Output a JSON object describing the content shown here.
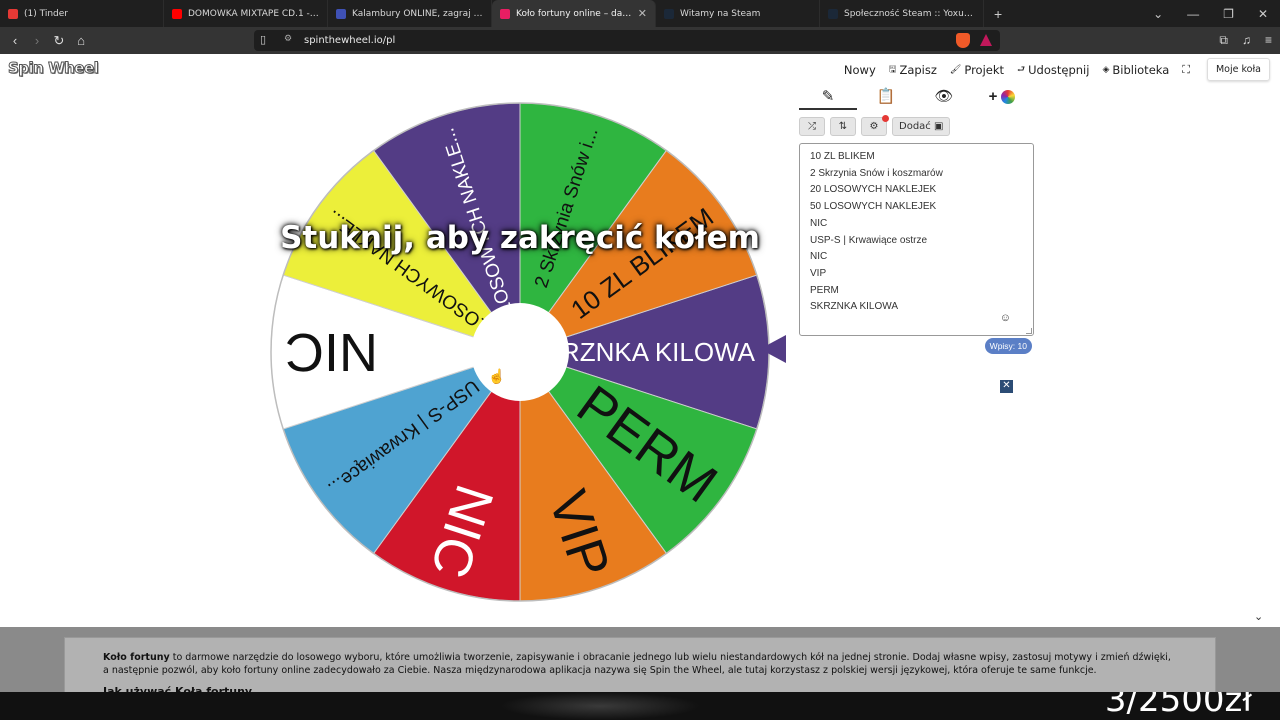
{
  "browser": {
    "tabs": [
      {
        "title": "(1) Tinder",
        "fav_color": "#e53935",
        "active": false
      },
      {
        "title": "DOMÓWKA MIXTAPE CD.1 - YouTube",
        "fav_color": "#ff0000",
        "active": false
      },
      {
        "title": "Kalambury ONLINE, zagraj - Kurnik",
        "fav_color": "#3f51b5",
        "active": false
      },
      {
        "title": "Koło fortuny online – darmowe losowanie",
        "fav_color": "#e91e63",
        "active": true
      },
      {
        "title": "Witamy na Steam",
        "fav_color": "#1b2838",
        "active": false
      },
      {
        "title": "Społeczność Steam :: Yoxumi :: Ekwipunek",
        "fav_color": "#1b2838",
        "active": false
      }
    ],
    "url": "spinthewheel.io/pl"
  },
  "site": {
    "logo": "Spin Wheel",
    "menu": {
      "nowy": "Nowy",
      "zapisz": "Zapisz",
      "projekt": "Projekt",
      "udostepnij": "Udostępnij",
      "biblioteka": "Biblioteka",
      "moje_kola": "Moje koła"
    },
    "tap_text": "Stuknij, aby zakręcić kołem"
  },
  "panel": {
    "add_label": "Dodać",
    "entries": [
      "10 ZL BLIKEM",
      "2 Skrzynia Snów i koszmarów",
      "20 LOSOWYCH NAKLEJEK",
      "50 LOSOWYCH NAKLEJEK",
      "NIC",
      "USP-S | Krwawiące ostrze",
      "NIC",
      "VIP",
      "PERM",
      "SKRZNKA KILOWA"
    ],
    "count_label": "Wpisy: 10"
  },
  "wheel": {
    "segments": [
      {
        "label": "SKRZNKA KILOWA",
        "color": "#533c85",
        "text_color": "#ffffff"
      },
      {
        "label": "PERM",
        "color": "#2fb540",
        "text_color": "#111111"
      },
      {
        "label": "VIP",
        "color": "#e87c1e",
        "text_color": "#111111"
      },
      {
        "label": "NIC",
        "color": "#d0162a",
        "text_color": "#ffffff"
      },
      {
        "label": "USP-S | Krwawiące...",
        "color": "#4fa3d1",
        "text_color": "#111111"
      },
      {
        "label": "NIC",
        "color": "#ffffff",
        "text_color": "#111111"
      },
      {
        "label": "50 LOSOWYCH NAKLE...",
        "color": "#ecef3a",
        "text_color": "#111111"
      },
      {
        "label": "20 LOSOWYCH NAKLE...",
        "color": "#533c85",
        "text_color": "#ffffff"
      },
      {
        "label": "2 Skrzynia Snów i...",
        "color": "#2fb540",
        "text_color": "#111111"
      },
      {
        "label": "10 ZL BLIKEM",
        "color": "#e87c1e",
        "text_color": "#111111"
      }
    ]
  },
  "info": {
    "brand": "Koło fortuny",
    "text": "to darmowe narzędzie do losowego wyboru, które umożliwia tworzenie, zapisywanie i obracanie jednego lub wielu niestandardowych kół na jednej stronie. Dodaj własne wpisy, zastosuj motywy i zmień dźwięki, a następnie pozwól, aby koło fortuny online zadecydowało za Ciebie. Nasza międzynarodowa aplikacja nazywa się Spin the Wheel, ale tutaj korzystasz z polskiej wersji językowej, która oferuje te same funkcje.",
    "subheading": "Jak używać Koła fortuny"
  },
  "overlay_text": "3/2500zł"
}
